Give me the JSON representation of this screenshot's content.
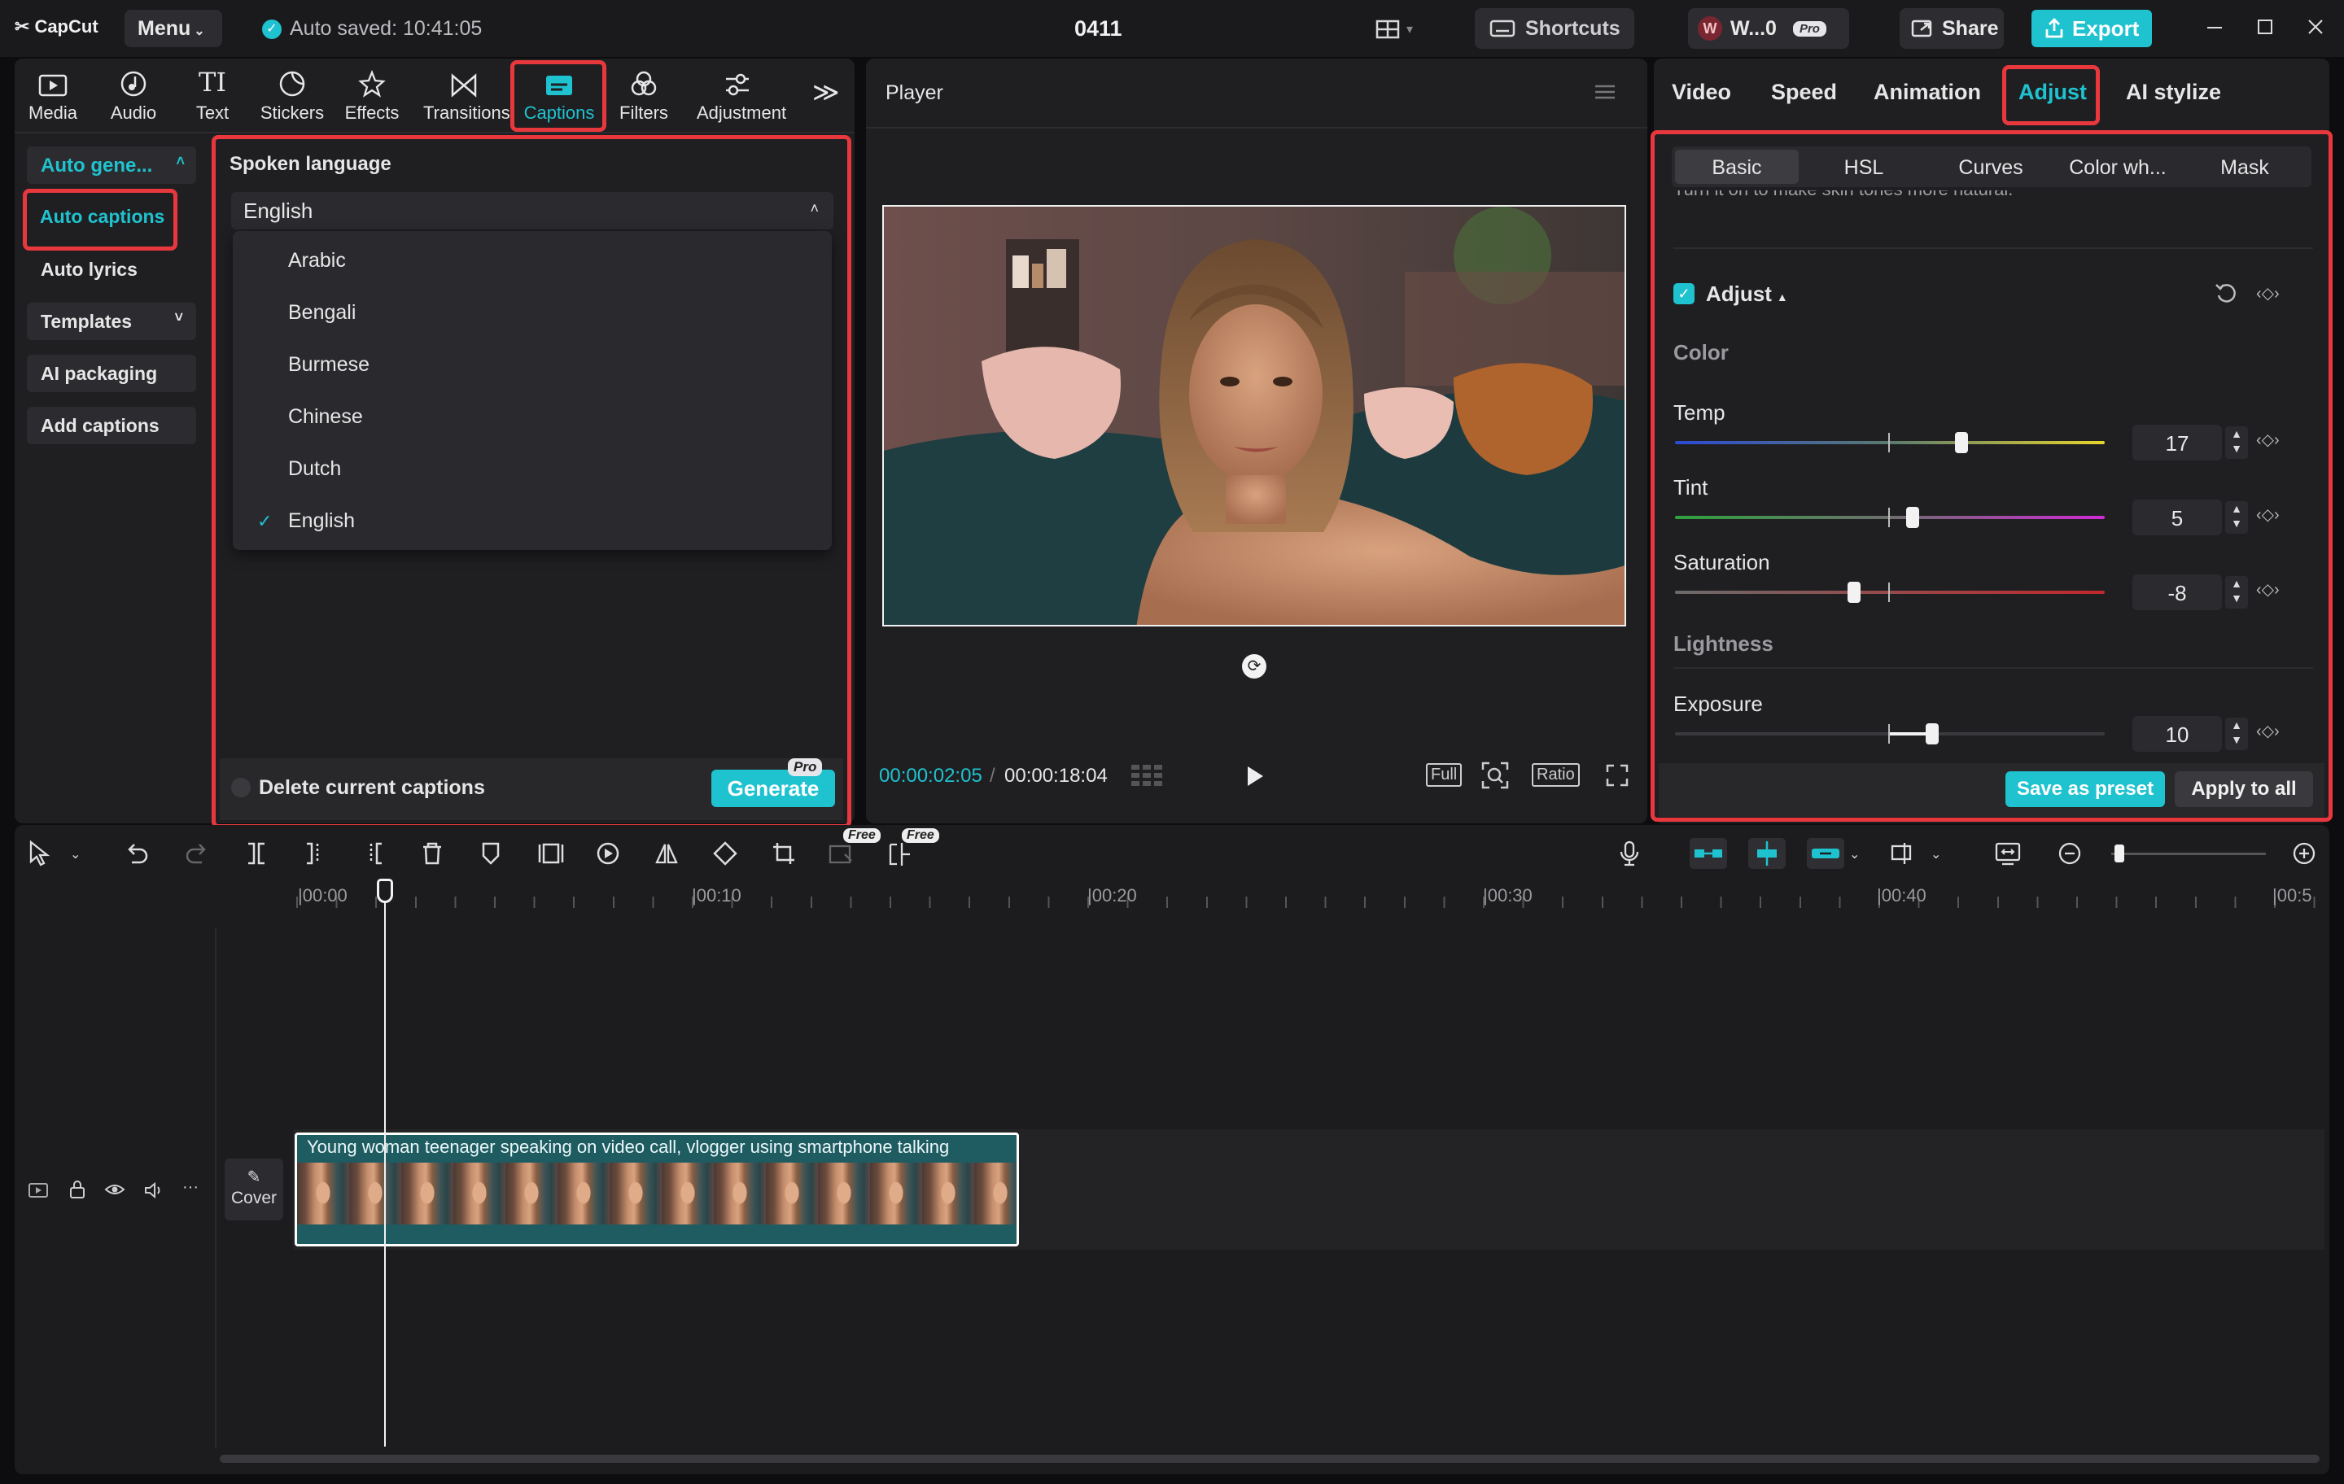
{
  "app": {
    "logo": "CapCut",
    "menu": "Menu",
    "autosave": "Auto saved: 10:41:05",
    "project_name": "0411",
    "shortcuts": "Shortcuts",
    "workspace": "W...0",
    "workspace_avatar": "W",
    "pro_badge": "Pro",
    "share": "Share",
    "export": "Export"
  },
  "toolbar": {
    "tools": [
      "Media",
      "Audio",
      "Text",
      "Stickers",
      "Effects",
      "Transitions",
      "Captions",
      "Filters",
      "Adjustment"
    ],
    "more": "≫"
  },
  "captions_sidebar": {
    "auto_generate": "Auto gene...",
    "auto_captions": "Auto captions",
    "auto_lyrics": "Auto lyrics",
    "templates": "Templates",
    "ai_packaging": "AI packaging",
    "add_captions": "Add captions"
  },
  "captions_panel": {
    "spoken_language_label": "Spoken language",
    "selected": "English",
    "options": [
      "Arabic",
      "Bengali",
      "Burmese",
      "Chinese",
      "Dutch",
      "English"
    ],
    "delete_current": "Delete current captions",
    "generate": "Generate",
    "generate_badge": "Pro"
  },
  "player": {
    "title": "Player",
    "current_time": "00:00:02:05",
    "total_time": "00:00:18:04",
    "full": "Full",
    "ratio": "Ratio"
  },
  "inspector": {
    "tabs": [
      "Video",
      "Speed",
      "Animation",
      "Adjust",
      "AI stylize"
    ],
    "active_tab": "Adjust",
    "subtabs": [
      "Basic",
      "HSL",
      "Curves",
      "Color wh...",
      "Mask"
    ],
    "active_subtab": "Basic",
    "hint": "Turn it on to make skin tones more natural.",
    "adjust_title": "Adjust",
    "color_section": "Color",
    "lightness_section": "Lightness",
    "sliders": [
      {
        "label": "Temp",
        "value": "17",
        "level": 0.67
      },
      {
        "label": "Tint",
        "value": "5",
        "level": 0.55
      },
      {
        "label": "Saturation",
        "value": "-8",
        "level": 0.42
      },
      {
        "label": "Exposure",
        "value": "10",
        "level": 0.6
      }
    ],
    "save_preset": "Save as preset",
    "apply_all": "Apply to all"
  },
  "timeline": {
    "ruler": [
      "00:00",
      "00:10",
      "00:20",
      "00:30",
      "00:40",
      "00:5"
    ],
    "free_badge": "Free",
    "cover": "Cover",
    "clip_title": "Young woman teenager speaking on video call, vlogger using smartphone talking"
  },
  "colors": {
    "accent": "#1fc2cf",
    "highlight": "#e9383d",
    "panel": "#1f1f22",
    "bg": "#0d0d0f"
  }
}
